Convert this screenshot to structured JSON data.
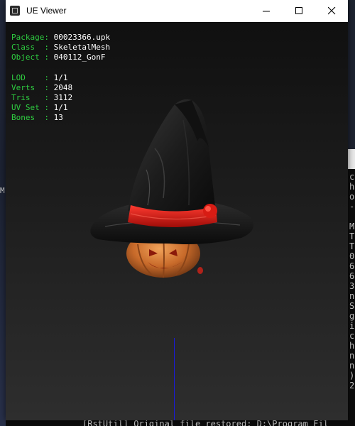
{
  "window": {
    "title": "UE Viewer",
    "controls": {
      "minimize": "minimize",
      "maximize": "maximize",
      "close": "close"
    }
  },
  "info": {
    "package_label": "Package: ",
    "package_value": "00023366.upk",
    "class_label": "Class  : ",
    "class_value": "SkeletalMesh",
    "object_label": "Object : ",
    "object_value": "040112_GonF",
    "lod_label": "LOD    : ",
    "lod_value": "1/1",
    "verts_label": "Verts  : ",
    "verts_value": "2048",
    "tris_label": "Tris   : ",
    "tris_value": "3112",
    "uvset_label": "UV Set : ",
    "uvset_value": "1/1",
    "bones_label": "Bones  : ",
    "bones_value": "13"
  },
  "colors": {
    "label_green": "#2ecc40",
    "value_white": "#ffffff",
    "axis_blue": "#1a1adc"
  },
  "model": {
    "description_icon": "witch-hat-pumpkin-mesh"
  },
  "background": {
    "left_fragment": "M",
    "console_right_chars": [
      "c",
      "h",
      "o",
      "-",
      "",
      "M",
      "T",
      "T",
      "0",
      "6",
      "6",
      "3",
      "n",
      "S",
      "g",
      "i",
      "c",
      "h",
      "n",
      "n",
      ")",
      "2"
    ],
    "console_bottom_line": "[RstUtil] Original file restored: D:\\Program Fil"
  }
}
